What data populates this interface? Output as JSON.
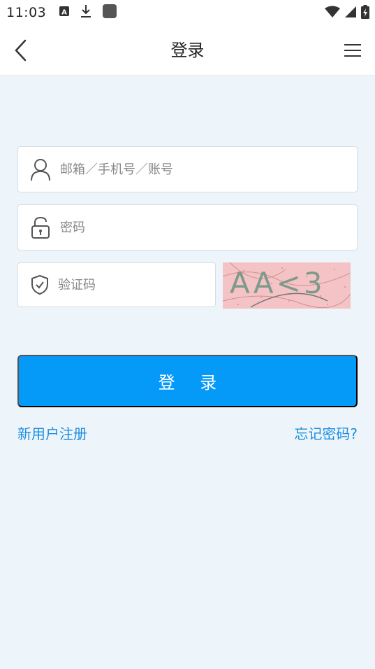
{
  "status_bar": {
    "time": "11:03",
    "icons_left": [
      "text-notification-icon",
      "download-icon",
      "app-square-icon"
    ],
    "icons_right": [
      "wifi-icon",
      "cell-signal-icon",
      "battery-charging-icon"
    ]
  },
  "app_bar": {
    "title": "登录",
    "back_icon": "chevron-left-icon",
    "menu_icon": "hamburger-menu-icon"
  },
  "form": {
    "account_placeholder": "邮箱／手机号／账号",
    "account_value": "",
    "password_placeholder": "密码",
    "password_value": "",
    "captcha_placeholder": "验证码",
    "captcha_value": "",
    "captcha_image_text": "AA<3"
  },
  "actions": {
    "login_label": "登 录",
    "register_label": "新用户注册",
    "forgot_label": "忘记密码?"
  },
  "colors": {
    "primary": "#0599f8",
    "link": "#1a8ee0",
    "page_background": "#eef5fa",
    "captcha_background": "#f3c3c6"
  }
}
